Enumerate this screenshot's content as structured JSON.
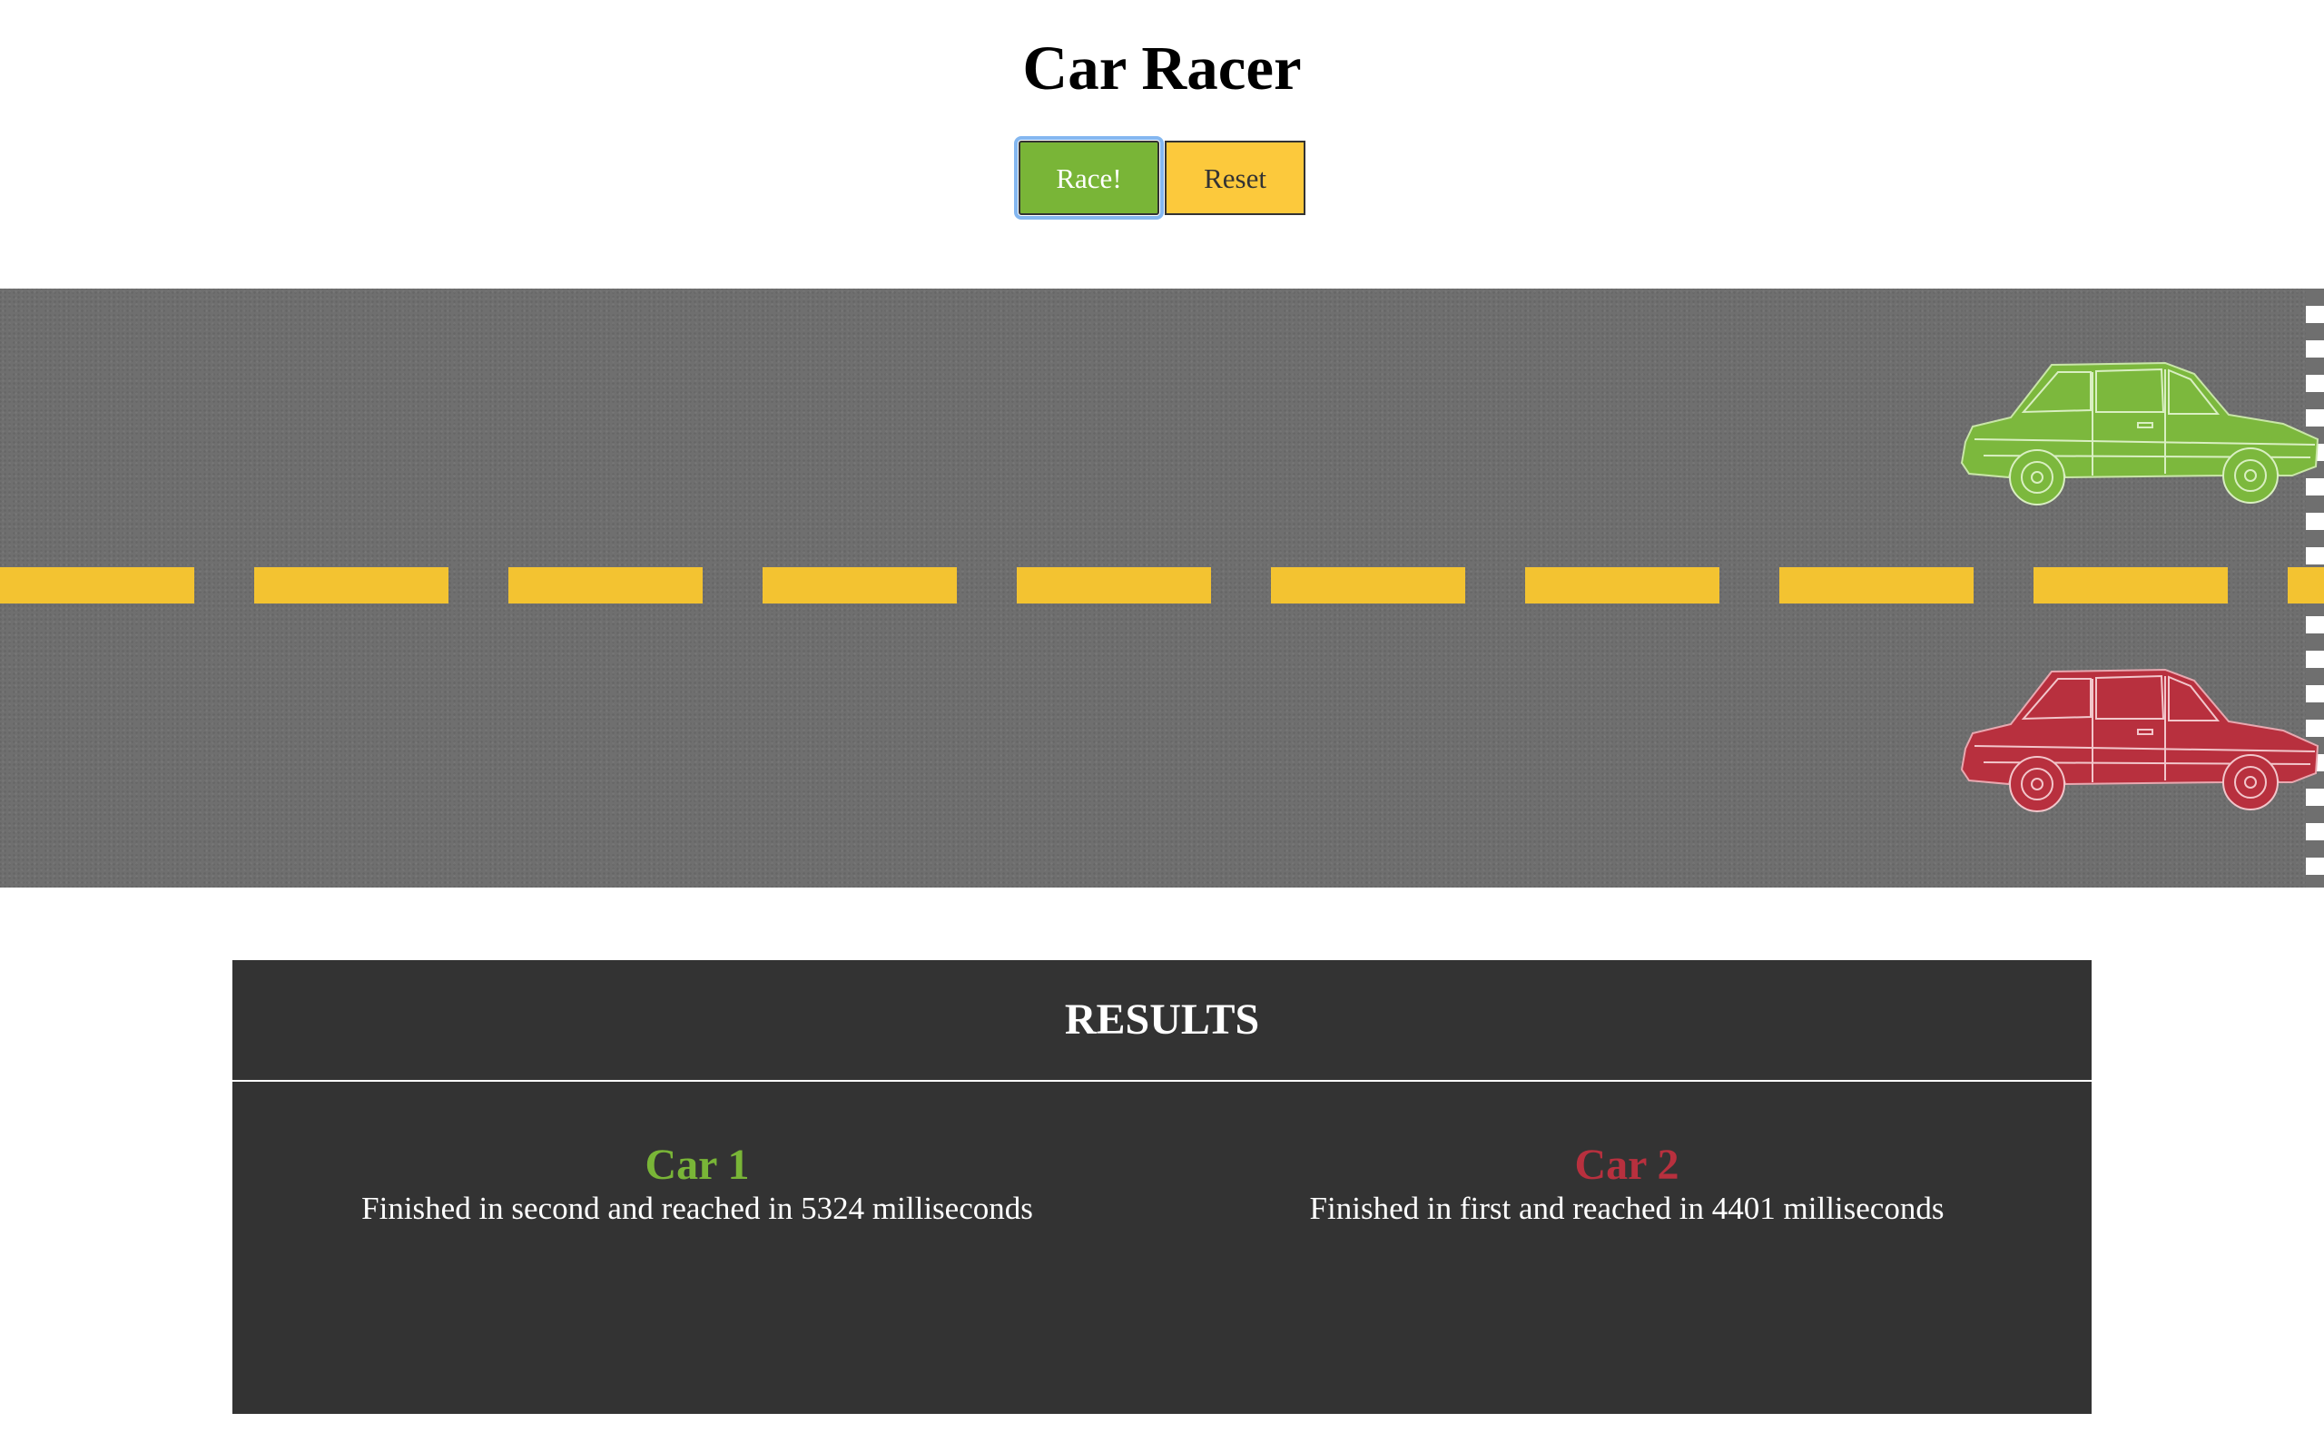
{
  "header": {
    "title": "Car Racer"
  },
  "controls": {
    "race_label": "Race!",
    "reset_label": "Reset"
  },
  "colors": {
    "race_button": "#79b537",
    "reset_button": "#fcc93c",
    "track": "#6f6f6f",
    "lane_line": "#f3c331",
    "car1": "#79b537",
    "car2": "#b8303e",
    "results_bg": "#333333"
  },
  "track": {
    "cars": [
      {
        "id": "car1",
        "color": "#79b537",
        "icon": "green-car-icon"
      },
      {
        "id": "car2",
        "color": "#b8303e",
        "icon": "red-car-icon"
      }
    ]
  },
  "results": {
    "title": "RESULTS",
    "entries": [
      {
        "name": "Car 1",
        "color": "#79b537",
        "text": "Finished in second and reached in 5324 milliseconds"
      },
      {
        "name": "Car 2",
        "color": "#b8303e",
        "text": "Finished in first and reached in 4401 milliseconds"
      }
    ]
  }
}
